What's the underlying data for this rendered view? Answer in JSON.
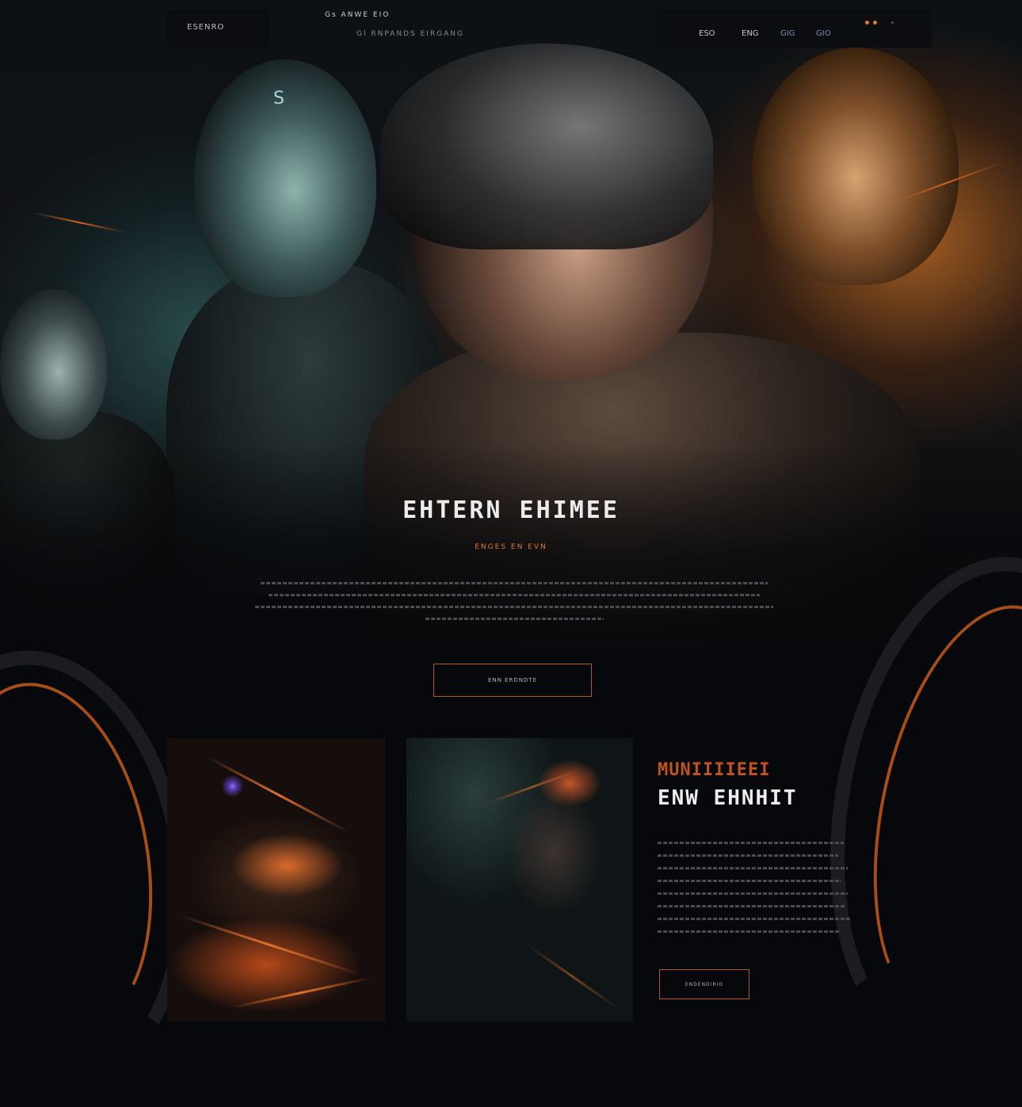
{
  "nav": {
    "brand": "ESENRO",
    "center_title": "Gs ANWE EIO",
    "center_subtitle": "Gl RNPANDS EIRGANG",
    "links": [
      "ESO",
      "ENG",
      "GIG",
      "GIO"
    ]
  },
  "hero": {
    "title": "EHTERN EHIMEE",
    "subtitle": "ENGES EN EVN",
    "button_label": "ENN ERDNDTE"
  },
  "feature": {
    "kicker": "MUNIIIIEEI",
    "title": "ENW EHNHIT",
    "button_label": "ENDENDIRIO"
  },
  "colors": {
    "accent": "#e07a2a",
    "background": "#07080b"
  },
  "icons": {
    "helmet_mark": "S"
  }
}
